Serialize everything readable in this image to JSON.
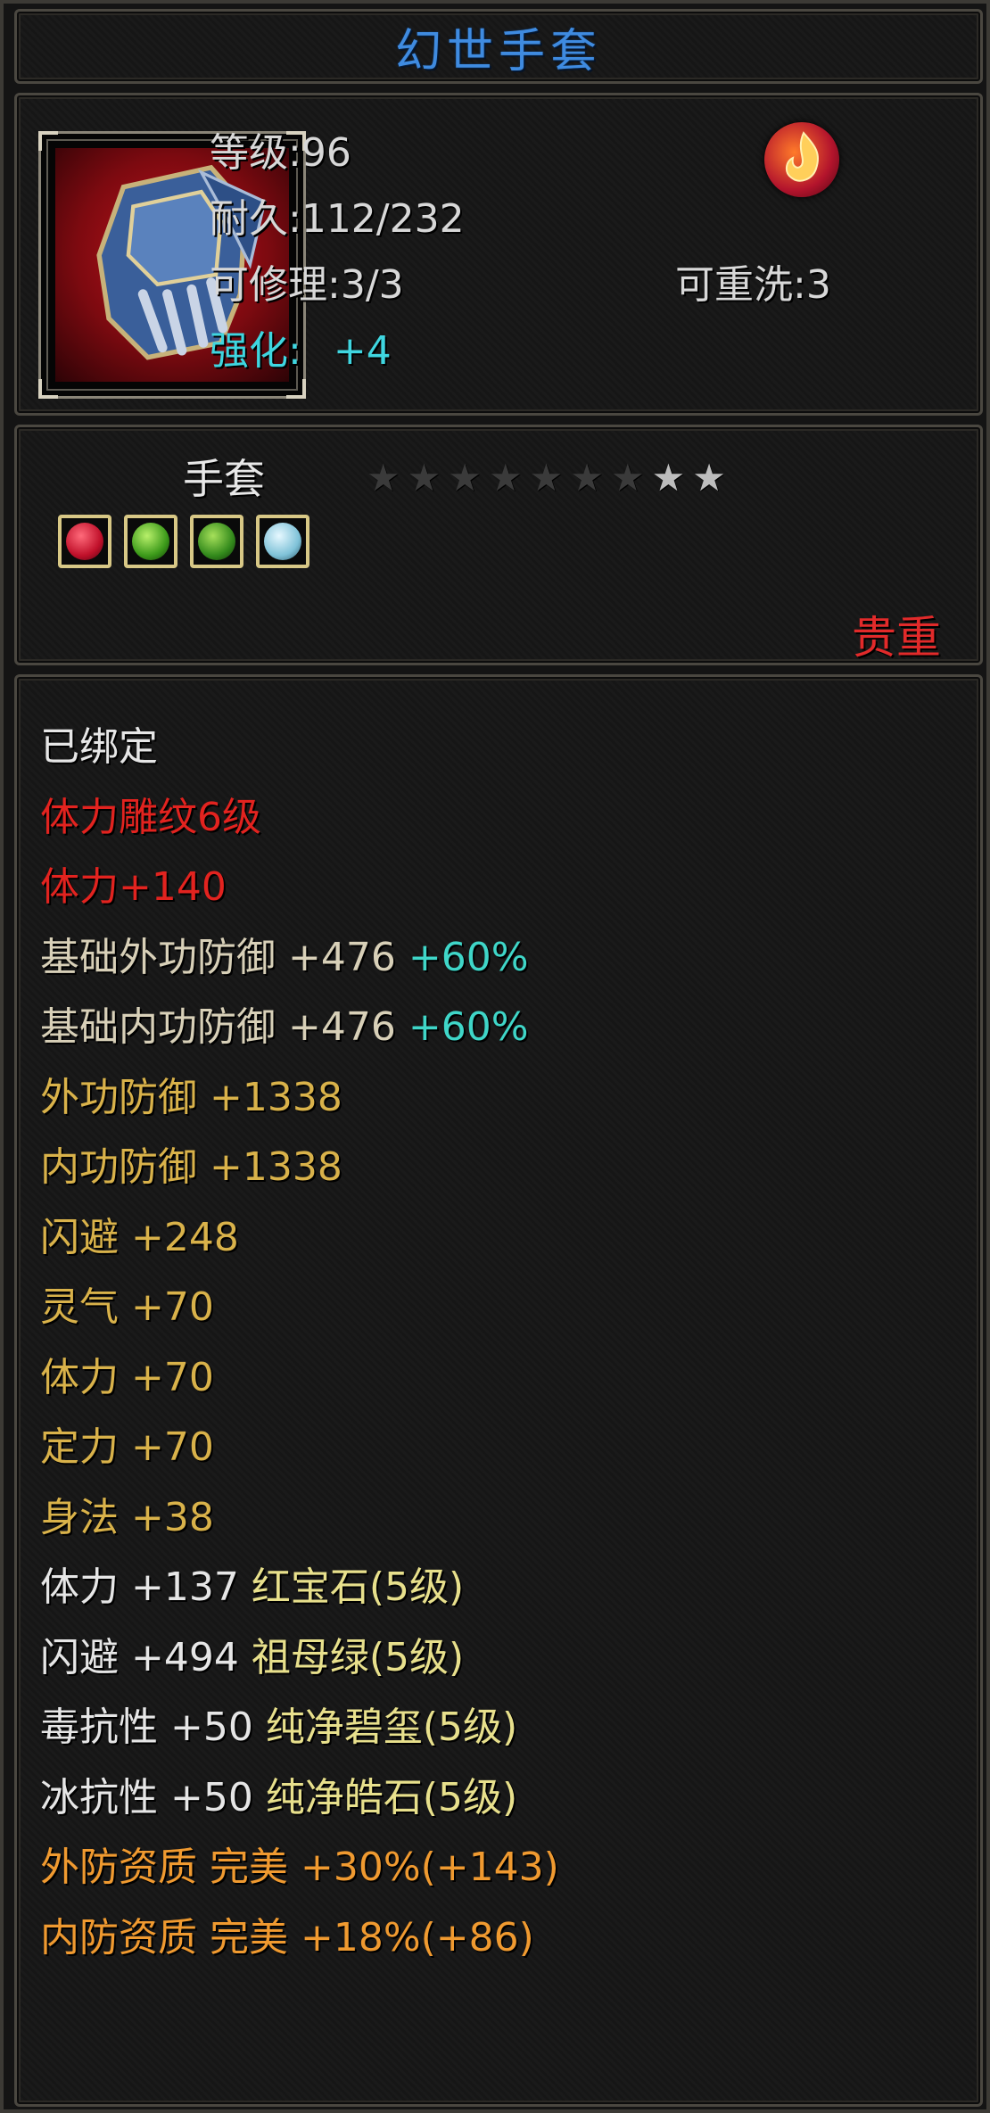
{
  "item": {
    "name": "幻世手套",
    "level": "等级:96",
    "durability": "耐久:112/232",
    "repairable": "可修理:3/3",
    "rewash": "可重洗:3",
    "enhance_label": "强化:",
    "enhance_value": "+4",
    "type": "手套",
    "rarity": "贵重",
    "stars": {
      "total": 9,
      "lit": 2
    },
    "gem_sockets": [
      "red-gem-icon",
      "green-gem-icon",
      "green-gem-icon",
      "blue-gem-icon"
    ],
    "corner_icon": "flame-icon"
  },
  "stats": [
    {
      "text": "已绑定",
      "color": "white"
    },
    {
      "text": "体力雕纹6级",
      "color": "red"
    },
    {
      "text": "体力+140",
      "color": "red"
    },
    {
      "text": "基础外功防御 +476",
      "extra": "+60%",
      "color": "tan"
    },
    {
      "text": "基础内功防御 +476",
      "extra": "+60%",
      "color": "tan"
    },
    {
      "text": "外功防御 +1338",
      "color": "gold"
    },
    {
      "text": "内功防御 +1338",
      "color": "gold"
    },
    {
      "text": "闪避 +248",
      "color": "gold"
    },
    {
      "text": "灵气 +70",
      "color": "gold"
    },
    {
      "text": "体力 +70",
      "color": "gold"
    },
    {
      "text": "定力 +70",
      "color": "gold"
    },
    {
      "text": "身法 +38",
      "color": "gold"
    },
    {
      "text": "体力 +137",
      "extra": "红宝石(5级)",
      "color": "white"
    },
    {
      "text": "闪避 +494",
      "extra": "祖母绿(5级)",
      "color": "white"
    },
    {
      "text": "毒抗性 +50",
      "extra": "纯净碧玺(5级)",
      "color": "white"
    },
    {
      "text": "冰抗性 +50",
      "extra": "纯净皓石(5级)",
      "color": "white"
    },
    {
      "text": "外防资质  完美 +30%(+143)",
      "color": "orange"
    },
    {
      "text": "内防资质  完美 +18%(+86)",
      "color": "orange"
    }
  ]
}
